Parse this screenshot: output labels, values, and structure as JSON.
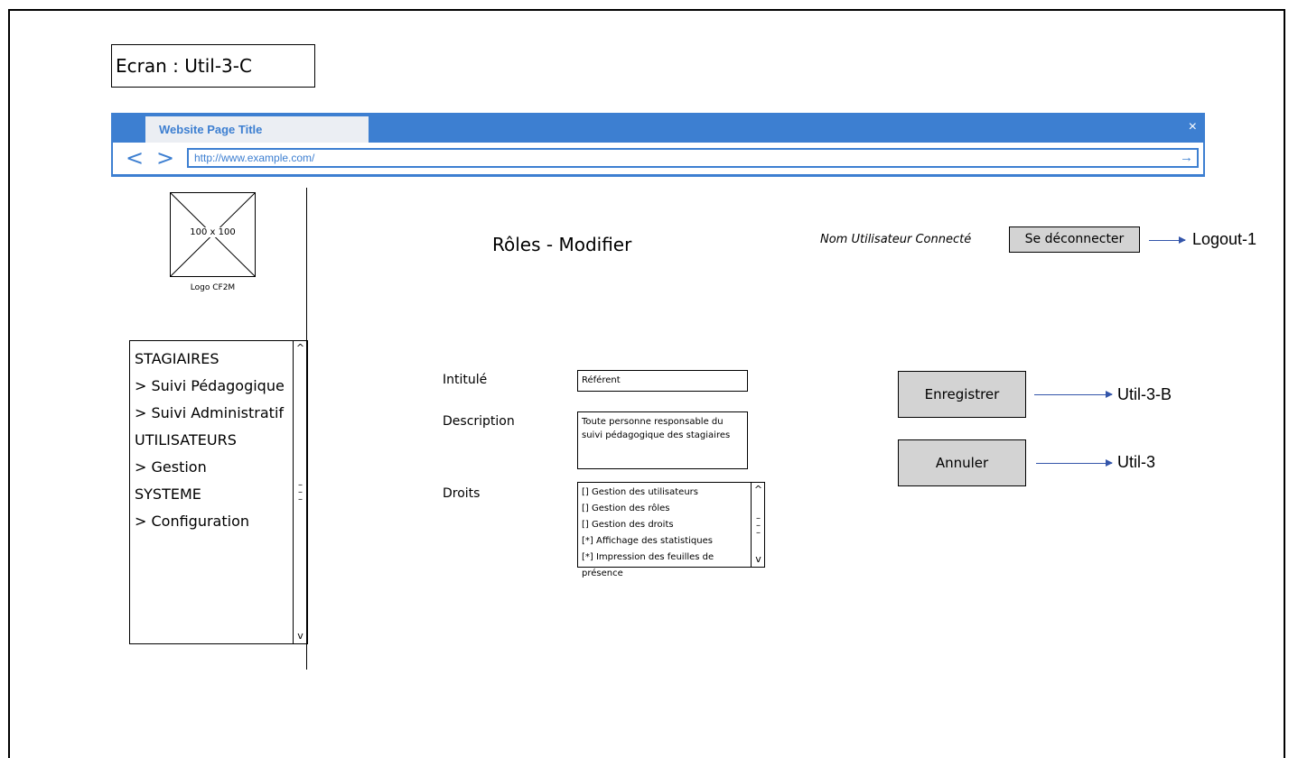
{
  "screen_label": "Ecran : Util-3-C",
  "browser": {
    "tab_title": "Website Page Title",
    "close_symbol": "×",
    "back_symbol": "<",
    "forward_symbol": ">",
    "url": "http://www.example.com/",
    "go_symbol": "→"
  },
  "sidebar": {
    "logo_size": "100 x 100",
    "logo_caption": "Logo CF2M",
    "menu": [
      "STAGIAIRES",
      "> Suivi Pédagogique",
      "> Suivi Administratif",
      "UTILISATEURS",
      "> Gestion",
      "SYSTEME",
      "> Configuration"
    ]
  },
  "header": {
    "title": "Rôles - Modifier",
    "user_name": "Nom Utilisateur Connecté",
    "logout_label": "Se déconnecter",
    "logout_target": "Logout-1"
  },
  "form": {
    "intitule_label": "Intitulé",
    "intitule_value": "Référent",
    "description_label": "Description",
    "description_value": "Toute personne responsable du suivi pédagogique des stagiaires",
    "droits_label": "Droits",
    "droits": [
      "[] Gestion des utilisateurs",
      "[] Gestion des rôles",
      "[] Gestion des droits",
      "[*] Affichage des statistiques",
      "[*] Impression des feuilles de",
      "présence"
    ]
  },
  "actions": {
    "save_label": "Enregistrer",
    "save_target": "Util-3-B",
    "cancel_label": "Annuler",
    "cancel_target": "Util-3"
  },
  "colors": {
    "browser_blue": "#3d7fd1",
    "button_gray": "#d3d3d3",
    "arrow_blue": "#3355aa"
  }
}
